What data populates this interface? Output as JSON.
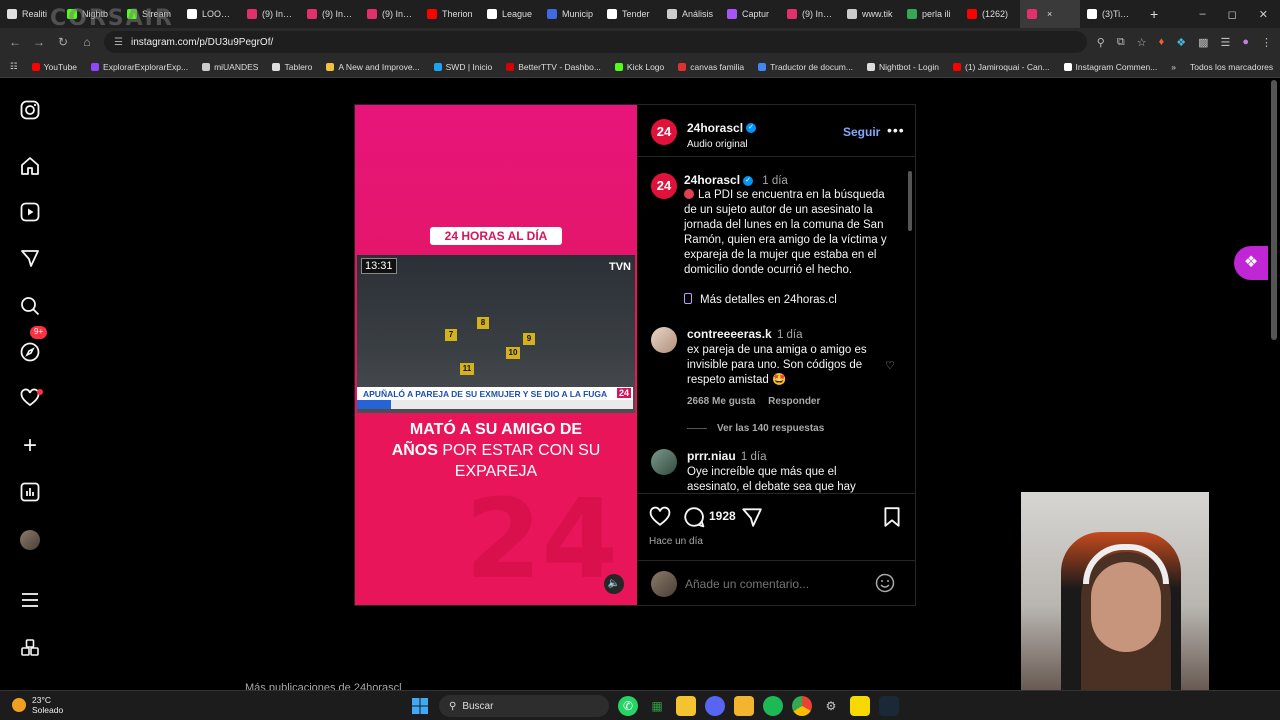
{
  "browser": {
    "tabs": [
      {
        "label": "Realiti",
        "color": "#e0e0e0"
      },
      {
        "label": "Nightb",
        "color": "#53fc18"
      },
      {
        "label": "Stream",
        "color": "#53fc18"
      },
      {
        "label": "LOOP S",
        "color": "#ffffff"
      },
      {
        "label": "(9) Insta",
        "color": "#e1306c"
      },
      {
        "label": "(9) Insta",
        "color": "#e1306c"
      },
      {
        "label": "(9) Insta",
        "color": "#e1306c"
      },
      {
        "label": "Therion",
        "color": "#ff0000"
      },
      {
        "label": "League",
        "color": "#ffffff"
      },
      {
        "label": "Municip",
        "color": "#4169e1"
      },
      {
        "label": "Tender",
        "color": "#ffffff"
      },
      {
        "label": "Análisis",
        "color": "#cccccc"
      },
      {
        "label": "Captur",
        "color": "#a855f7"
      },
      {
        "label": "(9) Insta",
        "color": "#e1306c"
      },
      {
        "label": "www.tik",
        "color": "#cccccc"
      },
      {
        "label": "perla ili",
        "color": "#34a853"
      },
      {
        "label": "(1262)",
        "color": "#ff0000"
      },
      {
        "label": "",
        "color": "#e1306c",
        "active": true
      },
      {
        "label": "(3)TikTo",
        "color": "#ffffff"
      }
    ],
    "watermark": "CORSAIR",
    "url": "instagram.com/p/DU3u9PegrOf/",
    "bookmarks": [
      {
        "label": "YouTube",
        "color": "#ff0000"
      },
      {
        "label": "ExplorarExplorarExp...",
        "color": "#9146ff"
      },
      {
        "label": "miUANDES",
        "color": "#cccccc"
      },
      {
        "label": "Tablero",
        "color": "#dddddd"
      },
      {
        "label": "A New and Improve...",
        "color": "#f0c040"
      },
      {
        "label": "SWD | Inicio",
        "color": "#1da1f2"
      },
      {
        "label": "BetterTTV - Dashbo...",
        "color": "#d50000"
      },
      {
        "label": "Kick Logo",
        "color": "#53fc18"
      },
      {
        "label": "canvas familia",
        "color": "#e03030"
      },
      {
        "label": "Traductor de docum...",
        "color": "#4285f4"
      },
      {
        "label": "Nightbot - Login",
        "color": "#dddddd"
      },
      {
        "label": "(1) Jamiroquai - Can...",
        "color": "#ff0000"
      },
      {
        "label": "Instagram Commen...",
        "color": "#ffffff"
      }
    ],
    "all_bookmarks": "Todos los marcadores"
  },
  "sidebar": {
    "notifications_badge": "9+"
  },
  "post": {
    "media": {
      "pill": "24 HORAS AL DÍA",
      "clock": "13:31",
      "channel": "TVN",
      "ticker": "APUÑALÓ A PAREJA DE SU EXMUJER Y SE DIO A LA FUGA",
      "ticker_logo": "24",
      "headline_bold1": "MATÓ A SU AMIGO DE",
      "headline_bold2": "AÑOS",
      "headline_rest2": " POR ESTAR CON SU",
      "headline_line3": "EXPAREJA",
      "markers": [
        "7",
        "8",
        "9",
        "10",
        "11"
      ],
      "bg_number": "24"
    },
    "header": {
      "avatar_text": "24",
      "username": "24horascl",
      "audio": "Audio original",
      "follow": "Seguir"
    },
    "caption": {
      "username": "24horascl",
      "time": "1 día",
      "text": "La PDI se encuentra en la búsqueda de un sujeto autor de un asesinato la jornada del lunes en la comuna de San Ramón, quien era amigo de la víctima y expareja de la mujer que estaba en el domicilio donde ocurrió el hecho.",
      "more": "Más detalles en 24horas.cl"
    },
    "comments": [
      {
        "username": "contreeeeras.k",
        "time": "1 día",
        "text": "ex pareja de una amiga o amigo es invisible para uno. Son códigos de respeto amistad 🤩",
        "likes": "2668 Me gusta",
        "reply": "Responder",
        "view_replies": "Ver las 140 respuestas"
      },
      {
        "username": "prrr.niau",
        "time": "1 día",
        "text": "Oye increíble que más que el asesinato, el debate sea que hay"
      }
    ],
    "comment_count": "1928",
    "time_ago": "Hace un día",
    "add_comment_placeholder": "Añade un comentario..."
  },
  "more_posts": "Más publicaciones de 24horascl",
  "taskbar": {
    "temp": "23°C",
    "weather": "Soleado",
    "search": "Buscar"
  }
}
